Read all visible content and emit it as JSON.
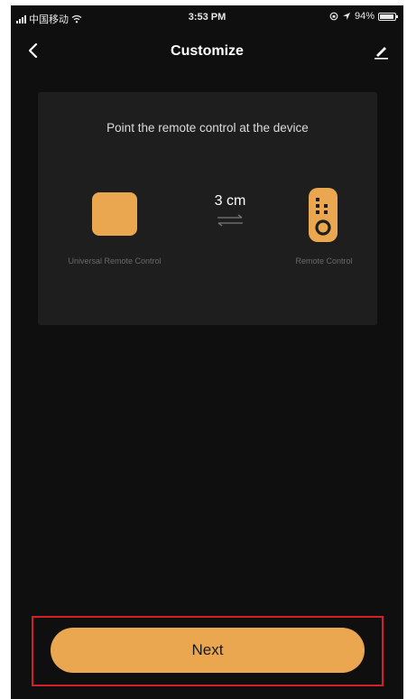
{
  "status_bar": {
    "carrier": "中国移动",
    "time": "3:53 PM",
    "battery": "94%"
  },
  "nav": {
    "title": "Customize",
    "back_icon": "chevron-left-icon",
    "edit_icon": "pencil-icon"
  },
  "pairing": {
    "instruction": "Point the remote control at the device",
    "distance": "3 cm",
    "left_label": "Universal Remote Control",
    "right_label": "Remote Control"
  },
  "footer": {
    "next_label": "Next"
  },
  "colors": {
    "accent": "#eaa74f",
    "background": "#0f0f0f",
    "card": "#1e1e1e",
    "highlight": "#d2202a"
  }
}
